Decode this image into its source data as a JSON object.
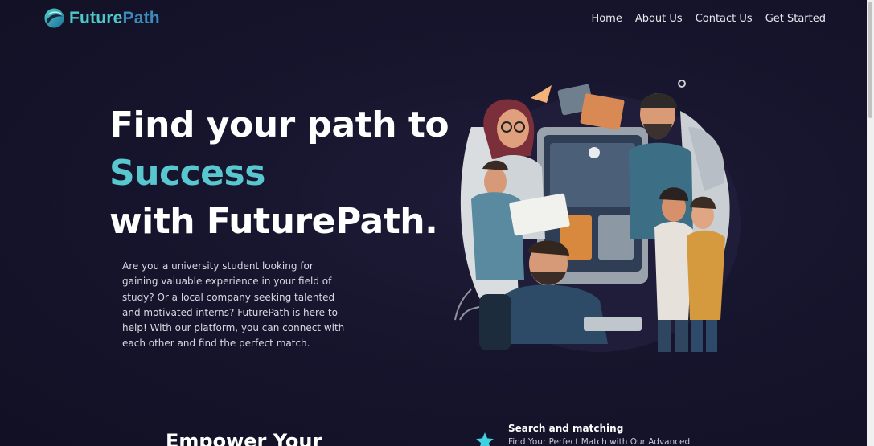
{
  "header": {
    "logo_text_first": "Future",
    "logo_text_second": "Path",
    "nav": [
      {
        "label": "Home"
      },
      {
        "label": "About Us"
      },
      {
        "label": "Contact Us"
      },
      {
        "label": "Get Started"
      }
    ]
  },
  "hero": {
    "title_line1": "Find your path to",
    "title_line2": "Success",
    "title_line3": "with FuturePath.",
    "description": "Are you a university student looking for gaining valuable experience in your field of study? Or a local company seeking talented and motivated interns? FuturePath is here to help! With our platform, you can connect with each other and find the perfect match."
  },
  "section": {
    "heading": "Empower Your",
    "feature": {
      "title": "Search and matching",
      "subtitle": "Find Your Perfect Match with Our Advanced"
    }
  },
  "colors": {
    "background": "#15132a",
    "accent_teal": "#58c7cf",
    "logo_blue": "#3a8bbb"
  },
  "icons": {
    "logo": "swirl-globe-icon",
    "feature": "star-icon"
  }
}
